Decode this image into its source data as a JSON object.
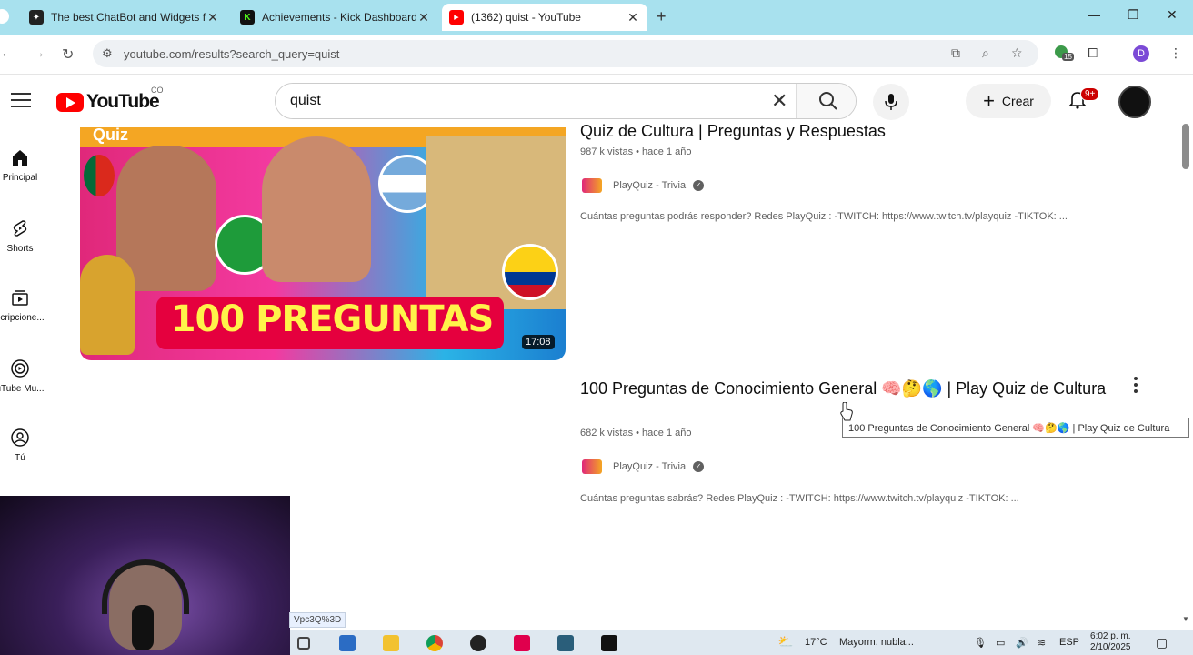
{
  "browser": {
    "tabs": [
      {
        "title": "The best ChatBot and Widgets f"
      },
      {
        "title": "Achievements - Kick Dashboard"
      },
      {
        "title": "(1362) quist - YouTube"
      }
    ],
    "url": "youtube.com/results?search_query=quist",
    "profile_initial": "D",
    "extension_badge": "15"
  },
  "youtube": {
    "logo_text": "YouTube",
    "country_code": "CO",
    "search_value": "quist",
    "create_label": "Crear",
    "notifications_badge": "9+",
    "sidebar": [
      {
        "label": "Principal"
      },
      {
        "label": "Shorts"
      },
      {
        "label": "scripcione..."
      },
      {
        "label": "uTube Mu..."
      },
      {
        "label": "Tú"
      }
    ],
    "results": [
      {
        "title": "Quiz de Cultura | Preguntas y Respuestas",
        "meta": "987 k vistas • hace 1 año",
        "channel": "PlayQuiz - Trivia",
        "description": "Cuántas preguntas podrás responder? Redes PlayQuiz : -TWITCH: https://www.twitch.tv/playquiz -TIKTOK: ...",
        "duration": "17:08",
        "thumbnail_text": "100 PREGUNTAS",
        "thumbnail_top_text": "Quiz"
      },
      {
        "title": "100 Preguntas de Conocimiento General 🧠🤔🌎 | Play Quiz de Cultura",
        "meta": "682 k vistas • hace 1 año",
        "channel": "PlayQuiz - Trivia",
        "description": "Cuántas preguntas sabrás? Redes PlayQuiz : -TWITCH: https://www.twitch.tv/playquiz -TIKTOK: ..."
      }
    ],
    "tooltip": "100 Preguntas de Conocimiento General 🧠🤔🌎 | Play Quiz de Cultura"
  },
  "status_url": "Vpc3Q%3D",
  "taskbar": {
    "weather_temp": "17°C",
    "weather_text": "Mayorm. nubla...",
    "language": "ESP",
    "time": "6:02 p. m.",
    "date": "2/10/2025"
  },
  "colors": {
    "tabstrip": "#a8e1ee",
    "youtube_red": "#ff0000",
    "taskbar": "#dfe8f0"
  }
}
